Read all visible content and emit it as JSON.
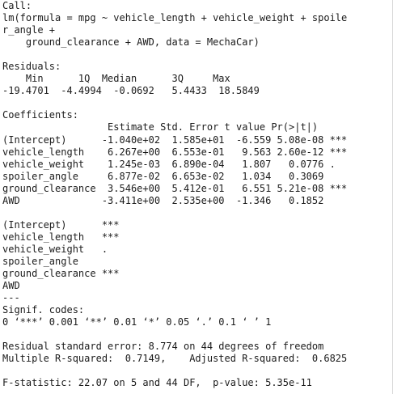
{
  "call": {
    "header": "Call:",
    "lines": [
      "lm(formula = mpg ~ vehicle_length + vehicle_weight + spoile",
      "r_angle + ",
      "    ground_clearance + AWD, data = MechaCar)"
    ]
  },
  "residuals": {
    "header": "Residuals:",
    "labels": "    Min      1Q  Median      3Q     Max ",
    "values": "-19.4701  -4.4994  -0.0692   5.4433  18.5849 "
  },
  "coefficients": {
    "header": "Coefficients:",
    "columns": "                  Estimate Std. Error t value Pr(>|t|)    ",
    "rows": [
      "(Intercept)      -1.040e+02  1.585e+01  -6.559 5.08e-08 ***",
      "vehicle_length    6.267e+00  6.553e-01   9.563 2.60e-12 ***",
      "vehicle_weight    1.245e-03  6.890e-04   1.807   0.0776 .  ",
      "spoiler_angle     6.877e-02  6.653e-02   1.034   0.3069    ",
      "ground_clearance  3.546e+00  5.412e-01   6.551 5.21e-08 ***",
      "AWD              -3.411e+00  2.535e+00  -1.346   0.1852    "
    ],
    "stars": [
      "(Intercept)      ***",
      "vehicle_length   ***",
      "vehicle_weight   .  ",
      "spoiler_angle       ",
      "ground_clearance ***",
      "AWD                 "
    ],
    "separator": "---"
  },
  "signif": {
    "header": "Signif. codes:  ",
    "codes": "0 ‘***’ 0.001 ‘**’ 0.01 ‘*’ 0.05 ‘.’ 0.1 ‘ ’ 1"
  },
  "fit": {
    "rse": "Residual standard error: 8.774 on 44 degrees of freedom",
    "r2": "Multiple R-squared:  0.7149,\tAdjusted R-squared:  0.6825 ",
    "fstat": "F-statistic: 22.07 on 5 and 44 DF,  p-value: 5.35e-11"
  }
}
